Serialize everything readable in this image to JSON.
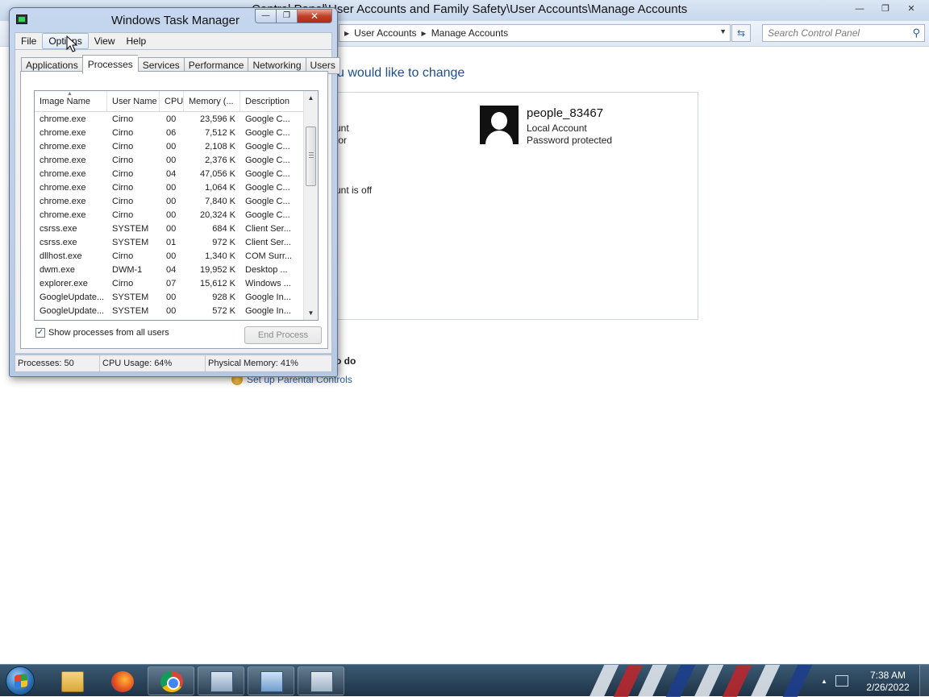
{
  "control_panel": {
    "title": "Control Panel\\User Accounts and Family Safety\\User Accounts\\Manage Accounts",
    "window_controls": {
      "minimize": "—",
      "maximize": "❐",
      "close": "✕"
    },
    "breadcrumb": [
      "User Accounts",
      "Manage Accounts"
    ],
    "search_placeholder": "Search Control Panel",
    "heading": "u would like to change",
    "fragments": {
      "frag1": "unt",
      "frag2": "tor",
      "frag3": "unt is off"
    },
    "account": {
      "name": "people_83467",
      "type": "Local Account",
      "status": "Password protected"
    },
    "section_fragment": "o do",
    "parental_link": "Set up Parental Controls"
  },
  "task_manager": {
    "title": "Windows Task Manager",
    "window_controls": {
      "minimize": "—",
      "maximize": "❐",
      "close": "✕"
    },
    "menus": [
      "File",
      "Options",
      "View",
      "Help"
    ],
    "tabs": [
      "Applications",
      "Processes",
      "Services",
      "Performance",
      "Networking",
      "Users"
    ],
    "active_tab": "Processes",
    "columns": [
      "Image Name",
      "User Name",
      "CPU",
      "Memory (...",
      "Description"
    ],
    "processes": [
      [
        "chrome.exe",
        "Cirno",
        "00",
        "23,596 K",
        "Google C..."
      ],
      [
        "chrome.exe",
        "Cirno",
        "06",
        "7,512 K",
        "Google C..."
      ],
      [
        "chrome.exe",
        "Cirno",
        "00",
        "2,108 K",
        "Google C..."
      ],
      [
        "chrome.exe",
        "Cirno",
        "00",
        "2,376 K",
        "Google C..."
      ],
      [
        "chrome.exe",
        "Cirno",
        "04",
        "47,056 K",
        "Google C..."
      ],
      [
        "chrome.exe",
        "Cirno",
        "00",
        "1,064 K",
        "Google C..."
      ],
      [
        "chrome.exe",
        "Cirno",
        "00",
        "7,840 K",
        "Google C..."
      ],
      [
        "chrome.exe",
        "Cirno",
        "00",
        "20,324 K",
        "Google C..."
      ],
      [
        "csrss.exe",
        "SYSTEM",
        "00",
        "684 K",
        "Client Ser..."
      ],
      [
        "csrss.exe",
        "SYSTEM",
        "01",
        "972 K",
        "Client Ser..."
      ],
      [
        "dllhost.exe",
        "Cirno",
        "00",
        "1,340 K",
        "COM Surr..."
      ],
      [
        "dwm.exe",
        "DWM-1",
        "04",
        "19,952 K",
        "Desktop ..."
      ],
      [
        "explorer.exe",
        "Cirno",
        "07",
        "15,612 K",
        "Windows ..."
      ],
      [
        "GoogleUpdate...",
        "SYSTEM",
        "00",
        "928 K",
        "Google In..."
      ],
      [
        "GoogleUpdate...",
        "SYSTEM",
        "00",
        "572 K",
        "Google In..."
      ]
    ],
    "show_all_label": "Show processes from all users",
    "show_all_checked": true,
    "end_process_label": "End Process",
    "status": {
      "processes": "Processes: 50",
      "cpu": "CPU Usage: 64%",
      "memory": "Physical Memory: 41%"
    }
  },
  "taskbar": {
    "items": [
      "start-orb",
      "folder-icon",
      "firefox-icon",
      "chrome-icon",
      "network-icon",
      "control-panel-icon",
      "task-manager-icon"
    ],
    "clock_time": "7:38 AM",
    "clock_date": "2/26/2022"
  }
}
